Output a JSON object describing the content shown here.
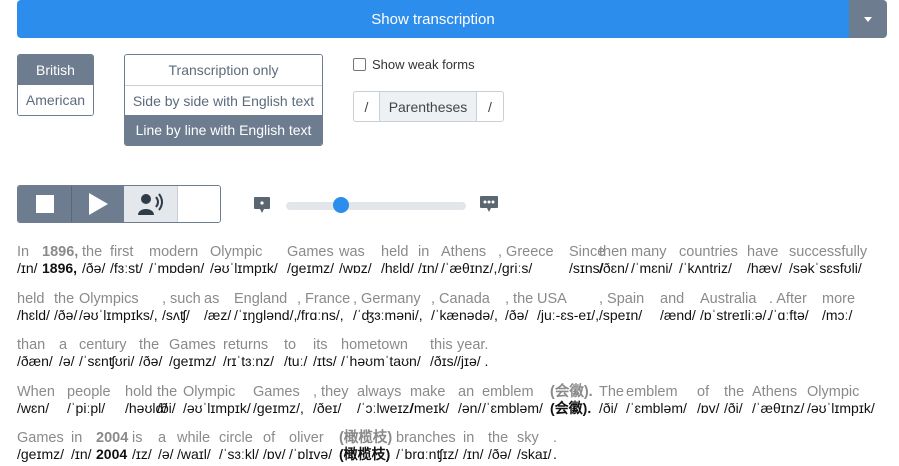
{
  "topbar": {
    "show_label": "Show transcription"
  },
  "accent": {
    "options": [
      "British",
      "American"
    ]
  },
  "mode": {
    "options": [
      "Transcription only",
      "Side by side with English text",
      "Line by line with English text"
    ]
  },
  "weak_forms": {
    "label": "Show weak forms"
  },
  "delimiters": {
    "left": "/",
    "middle": "Parentheses",
    "right": "/"
  },
  "speed": {
    "value": 0.3
  },
  "lines": [
    [
      {
        "w": "In",
        "p": "/ɪn/"
      },
      {
        "w": "1896,",
        "p": "1896,",
        "b": true
      },
      {
        "w": "the",
        "p": "/ðə/"
      },
      {
        "w": "first",
        "p": "/fɜːst/"
      },
      {
        "w": "modern",
        "p": "/ˈmɒdən/"
      },
      {
        "w": "Olympic",
        "p": "/əʊˈlɪmpɪk/"
      },
      {
        "w": "Games",
        "p": "/ɡeɪmz/"
      },
      {
        "w": "was",
        "p": "/wɒz/"
      },
      {
        "w": "held",
        "p": "/hɛld/"
      },
      {
        "w": "in",
        "p": "/ɪn/"
      },
      {
        "w": "Athens",
        "p": "/ˈæθɪnz/,"
      },
      {
        "w": ", Greece",
        "p": "/ɡriːs/"
      },
      {
        "w": "Since",
        "p": "/sɪns/"
      },
      {
        "w": "then",
        "p": "/ðɛn/"
      },
      {
        "w": "many",
        "p": "/ˈmɛni/"
      },
      {
        "w": "countries",
        "p": "/ˈkʌntriz/"
      },
      {
        "w": "have",
        "p": "/hæv/"
      },
      {
        "w": "successfully",
        "p": "/səkˈsɛsfʊli/"
      }
    ],
    [
      {
        "w": "held",
        "p": "/hɛld/"
      },
      {
        "w": "the",
        "p": "/ðə/"
      },
      {
        "w": "Olympics",
        "p": "/əʊˈlɪmpɪks/,"
      },
      {
        "w": ", such",
        "p": "/sʌʧ/"
      },
      {
        "w": "as",
        "p": "/æz/"
      },
      {
        "w": "England",
        "p": "/ˈɪŋɡlənd/,"
      },
      {
        "w": ", France",
        "p": "/frɑːns/,"
      },
      {
        "w": ", Germany",
        "p": "/ˈʤɜːməni/,"
      },
      {
        "w": ", Canada",
        "p": "/ˈkænədə/,"
      },
      {
        "w": ", the",
        "p": "/ðə/"
      },
      {
        "w": "USA",
        "p": "/juː-ɛs-eɪ/,"
      },
      {
        "w": ", Spain",
        "p": "/speɪn/"
      },
      {
        "w": "and",
        "p": "/ænd/"
      },
      {
        "w": "Australia",
        "p": "/ɒˈstreɪliːə/."
      },
      {
        "w": ". After",
        "p": "/ˈɑːftə/"
      },
      {
        "w": "more",
        "p": "/mɔː/"
      }
    ],
    [
      {
        "w": "than",
        "p": "/ðæn/"
      },
      {
        "w": "a",
        "p": "/ə/"
      },
      {
        "w": "century",
        "p": "/ˈsɛnʧʊri/"
      },
      {
        "w": "the",
        "p": "/ðə/"
      },
      {
        "w": "Games",
        "p": "/ɡeɪmz/"
      },
      {
        "w": "returns",
        "p": "/rɪˈtɜːnz/"
      },
      {
        "w": "to",
        "p": "/tuː/"
      },
      {
        "w": "its",
        "p": "/ɪts/"
      },
      {
        "w": "hometown",
        "p": "/ˈhəʊmˈtaʊn/"
      },
      {
        "w": "this",
        "p": "/ðɪs/"
      },
      {
        "w": "year.",
        "p": "/jɪə/ ."
      }
    ],
    [
      {
        "w": "When",
        "p": "/wɛn/"
      },
      {
        "w": "people",
        "p": "/ˈpiːpl/"
      },
      {
        "w": "hold",
        "p": "/həʊld/"
      },
      {
        "w": "the",
        "p": "/ði/"
      },
      {
        "w": "Olympic",
        "p": "/əʊˈlɪmpɪk/"
      },
      {
        "w": "Games",
        "p": "/ɡeɪmz/,"
      },
      {
        "w": ", they",
        "p": "/ðeɪ/"
      },
      {
        "w": "always",
        "p": "/ˈɔːlweɪz/"
      },
      {
        "w": "make",
        "p": "/meɪk/"
      },
      {
        "w": "an",
        "p": "/ən/"
      },
      {
        "w": "emblem",
        "p": "/ˈɛmbləm/"
      },
      {
        "w": "(会徽).",
        "p": "(会徽).",
        "b": true
      },
      {
        "w": "The",
        "p": "/ði/"
      },
      {
        "w": "emblem",
        "p": "/ˈɛmbləm/"
      },
      {
        "w": "of",
        "p": "/ɒv/"
      },
      {
        "w": "the",
        "p": "/ði/"
      },
      {
        "w": "Athens",
        "p": "/ˈæθɪnz/"
      },
      {
        "w": "Olympic",
        "p": "/əʊˈlɪmpɪk/"
      }
    ],
    [
      {
        "w": "Games",
        "p": "/ɡeɪmz/"
      },
      {
        "w": "in",
        "p": "/ɪn/"
      },
      {
        "w": "2004",
        "p": "2004",
        "b": true
      },
      {
        "w": "is",
        "p": "/ɪz/"
      },
      {
        "w": "a",
        "p": "/ə/"
      },
      {
        "w": "while",
        "p": "/waɪl/"
      },
      {
        "w": "circle",
        "p": "/ˈsɜːkl/"
      },
      {
        "w": "of",
        "p": "/ɒv/"
      },
      {
        "w": "oliver",
        "p": "/ˈɒlɪvə/"
      },
      {
        "w": "(橄榄枝)",
        "p": "(橄榄枝)",
        "b": true
      },
      {
        "w": "branches",
        "p": "/ˈbrɑːnʧɪz/"
      },
      {
        "w": "in",
        "p": "/ɪn/"
      },
      {
        "w": "the",
        "p": "/ðə/"
      },
      {
        "w": "sky",
        "p": "/skaɪ/"
      },
      {
        "w": ".",
        "p": "."
      }
    ]
  ]
}
